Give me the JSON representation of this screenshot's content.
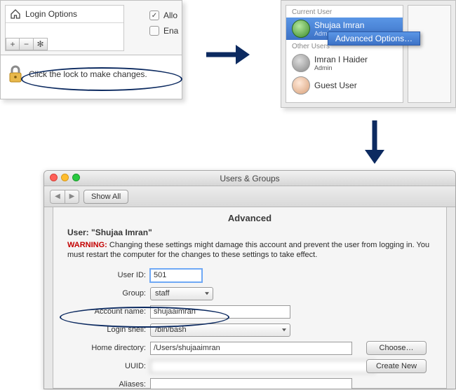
{
  "panel1": {
    "login_options_label": "Login Options",
    "btn_add": "+",
    "btn_remove": "−",
    "btn_gear": "✻",
    "check_allow_label": "Allo",
    "check_enable_label": "Ena",
    "lock_text": "Click the lock to make changes."
  },
  "panel2": {
    "section_current": "Current User",
    "section_other": "Other Users",
    "users": {
      "current": {
        "name": "Shujaa Imran",
        "role": "Admin"
      },
      "other1": {
        "name": "Imran I Haider",
        "role": "Admin"
      },
      "guest": {
        "name": "Guest User",
        "role": ""
      }
    },
    "context_item": "Advanced Options…"
  },
  "panel3": {
    "window_title": "Users & Groups",
    "toolbar": {
      "show_all": "Show All"
    },
    "sheet_title": "Advanced",
    "user_prefix": "User: ",
    "user_name_quoted": "\"Shujaa Imran\"",
    "warning_label": "WARNING:",
    "warning_text": "Changing these settings might damage this account and prevent the user from logging in. You must restart the computer for the changes to these settings to take effect.",
    "labels": {
      "user_id": "User ID:",
      "group": "Group:",
      "account_name": "Account name:",
      "login_shell": "Login shell:",
      "home_dir": "Home directory:",
      "uuid": "UUID:",
      "aliases": "Aliases:"
    },
    "values": {
      "user_id": "501",
      "group": "staff",
      "account_name": "shujaaimran",
      "login_shell": "/bin/bash",
      "home_dir": "/Users/shujaaimran",
      "uuid_masked": ""
    },
    "buttons": {
      "choose": "Choose…",
      "create_new": "Create New"
    }
  }
}
